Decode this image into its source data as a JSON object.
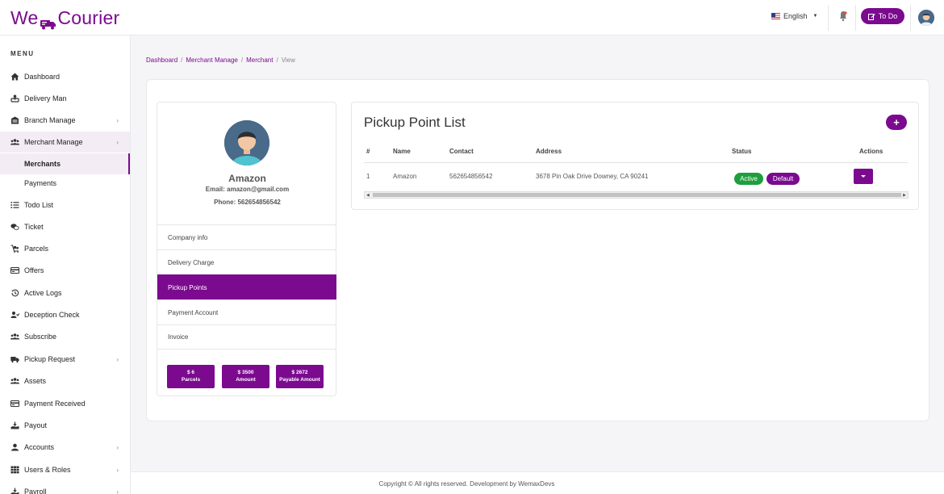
{
  "header": {
    "logo_text_1": "We",
    "logo_text_2": "Courier",
    "language": "English",
    "todo_label": "To Do"
  },
  "sidebar": {
    "menu_title": "MENU",
    "items": [
      {
        "label": "Dashboard",
        "icon": "home-icon",
        "chevron": false
      },
      {
        "label": "Delivery Man",
        "icon": "delivery-man-icon",
        "chevron": false
      },
      {
        "label": "Branch Manage",
        "icon": "branch-icon",
        "chevron": true
      },
      {
        "label": "Merchant Manage",
        "icon": "users-icon",
        "chevron": true,
        "active": true
      },
      {
        "label": "Merchants",
        "icon": "",
        "sub": true,
        "active": true
      },
      {
        "label": "Payments",
        "icon": "",
        "sub": true
      },
      {
        "label": "Todo List",
        "icon": "list-icon",
        "chevron": false
      },
      {
        "label": "Ticket",
        "icon": "ticket-icon",
        "chevron": false
      },
      {
        "label": "Parcels",
        "icon": "parcels-icon",
        "chevron": false
      },
      {
        "label": "Offers",
        "icon": "offers-icon",
        "chevron": false
      },
      {
        "label": "Active Logs",
        "icon": "history-icon",
        "chevron": false
      },
      {
        "label": "Deception Check",
        "icon": "user-check-icon",
        "chevron": false
      },
      {
        "label": "Subscribe",
        "icon": "subscribe-icon",
        "chevron": false
      },
      {
        "label": "Pickup Request",
        "icon": "truck-icon",
        "chevron": true
      },
      {
        "label": "Assets",
        "icon": "assets-icon",
        "chevron": false
      },
      {
        "label": "Payment Received",
        "icon": "payment-icon",
        "chevron": false
      },
      {
        "label": "Payout",
        "icon": "payout-icon",
        "chevron": false
      },
      {
        "label": "Accounts",
        "icon": "account-icon",
        "chevron": true
      },
      {
        "label": "Users & Roles",
        "icon": "grid-icon",
        "chevron": true
      },
      {
        "label": "Payroll",
        "icon": "payroll-icon",
        "chevron": true
      }
    ]
  },
  "breadcrumb": {
    "items": [
      "Dashboard",
      "Merchant Manage",
      "Merchant"
    ],
    "current": "View",
    "separator": "/"
  },
  "profile": {
    "name": "Amazon",
    "email": "Email: amazon@gmail.com",
    "phone": "Phone: 562654856542",
    "nav": [
      "Company info",
      "Delivery Charge",
      "Pickup Points",
      "Payment Account",
      "Invoice"
    ],
    "active_nav": "Pickup Points",
    "stats": [
      {
        "value": "$ 6",
        "label": "Parcels"
      },
      {
        "value": "$ 3500",
        "label": "Amount"
      },
      {
        "value": "$ 2672",
        "label": "Payable Amount"
      }
    ]
  },
  "pickup": {
    "title": "Pickup Point List",
    "add_icon": "plus-icon",
    "columns": [
      "#",
      "Name",
      "Contact",
      "Address",
      "Status",
      "Actions"
    ],
    "rows": [
      {
        "num": "1",
        "name": "Amazon",
        "contact": "562654856542",
        "address": "3678 Pin Oak Drive Downey, CA 90241",
        "status": "Active",
        "default": "Default"
      }
    ]
  },
  "colors": {
    "brand": "#7b0a8f",
    "active_badge": "#1e9e3c"
  },
  "footer": {
    "text": "Copyright © All rights reserved. Development by WemaxDevs"
  }
}
